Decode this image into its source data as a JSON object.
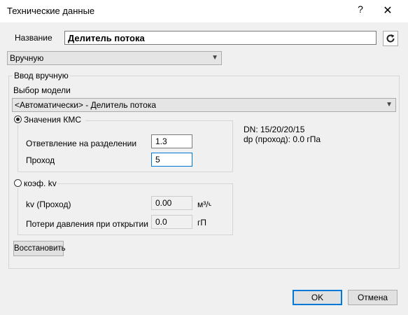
{
  "window": {
    "title": "Технические данные",
    "help": "?",
    "close": "✕"
  },
  "name_row": {
    "label": "Название",
    "value": "Делитель потока",
    "refresh_icon": "refresh-icon"
  },
  "mode_select": {
    "value": "Вручную"
  },
  "manual_group": {
    "title": "Ввод вручную",
    "model_label": "Выбор модели",
    "model_value": "<Автоматически> - Делитель потока",
    "kmc": {
      "title": "Значения КМС",
      "selected": true,
      "branch_label": "Ответвление на разделении",
      "branch_value": "1.3",
      "pass_label": "Проход",
      "pass_value": "5"
    },
    "info": {
      "dn": "DN: 15/20/20/15",
      "dp": "dp (проход): 0.0 гПа"
    },
    "kv": {
      "title": "коэф. kv",
      "selected": false,
      "kv_label": "kv (Проход)",
      "kv_value": "0.00",
      "kv_unit": "м³/ч",
      "loss_label": "Потери давления при открытии",
      "loss_value": "0.0",
      "loss_unit": "гП"
    },
    "restore_label": "Восстановить"
  },
  "footer": {
    "ok_label": "OK",
    "cancel_label": "Отмена"
  }
}
